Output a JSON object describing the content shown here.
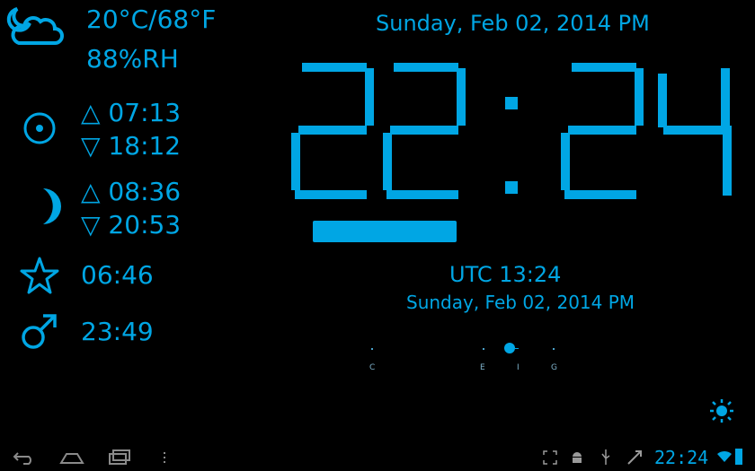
{
  "weather": {
    "icon": "moon-cloud-icon",
    "temperature": "20°C/68°F",
    "humidity": "88%RH"
  },
  "sun": {
    "icon": "sun-circle-icon",
    "rise": "△ 07:13",
    "set": "▽ 18:12"
  },
  "moon": {
    "icon": "crescent-moon-icon",
    "rise": "△ 08:36",
    "set": "▽ 20:53"
  },
  "alarm1": {
    "icon": "star-icon",
    "time": "06:46"
  },
  "alarm2": {
    "icon": "male-symbol-icon",
    "time": "23:49"
  },
  "clock": {
    "date": "Sunday, Feb 02, 2014 PM",
    "hours": "22",
    "minutes": "24",
    "digit_color": "#00a6e4"
  },
  "utc": {
    "time": "UTC 13:24",
    "date": "Sunday, Feb 02, 2014 PM"
  },
  "scale": {
    "labels": [
      "C",
      "E",
      "I",
      "G"
    ]
  },
  "brightness": {
    "icon": "sun-brightness-icon"
  },
  "statusbar": {
    "time": "22:24",
    "nav": [
      "back-icon",
      "home-icon",
      "recent-apps-icon",
      "menu-icon"
    ],
    "tray": [
      "fullscreen-icon",
      "android-icon",
      "usb-icon",
      "rocket-icon",
      "wifi-icon",
      "battery-icon"
    ]
  }
}
